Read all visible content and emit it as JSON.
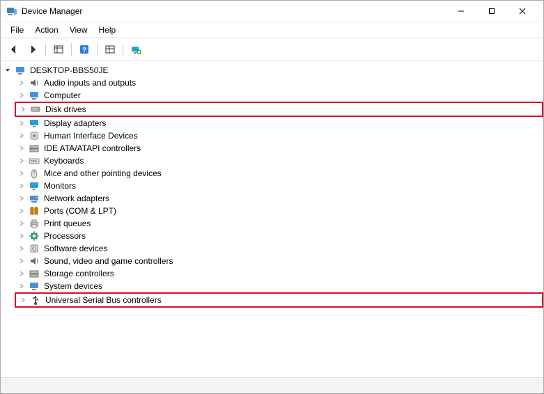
{
  "window": {
    "title": "Device Manager"
  },
  "menu": {
    "file": "File",
    "action": "Action",
    "view": "View",
    "help": "Help"
  },
  "tree": {
    "root": {
      "label": "DESKTOP-BBS50JE",
      "icon": "computer"
    },
    "categories": [
      {
        "label": "Audio inputs and outputs",
        "icon": "audio",
        "highlighted": false
      },
      {
        "label": "Computer",
        "icon": "computer",
        "highlighted": false
      },
      {
        "label": "Disk drives",
        "icon": "disk",
        "highlighted": true
      },
      {
        "label": "Display adapters",
        "icon": "display",
        "highlighted": false
      },
      {
        "label": "Human Interface Devices",
        "icon": "hid",
        "highlighted": false
      },
      {
        "label": "IDE ATA/ATAPI controllers",
        "icon": "storage",
        "highlighted": false
      },
      {
        "label": "Keyboards",
        "icon": "keyboard",
        "highlighted": false
      },
      {
        "label": "Mice and other pointing devices",
        "icon": "mouse",
        "highlighted": false
      },
      {
        "label": "Monitors",
        "icon": "monitor",
        "highlighted": false
      },
      {
        "label": "Network adapters",
        "icon": "network",
        "highlighted": false
      },
      {
        "label": "Ports (COM & LPT)",
        "icon": "port",
        "highlighted": false
      },
      {
        "label": "Print queues",
        "icon": "printer",
        "highlighted": false
      },
      {
        "label": "Processors",
        "icon": "cpu",
        "highlighted": false
      },
      {
        "label": "Software devices",
        "icon": "software",
        "highlighted": false
      },
      {
        "label": "Sound, video and game controllers",
        "icon": "sound",
        "highlighted": false
      },
      {
        "label": "Storage controllers",
        "icon": "storage",
        "highlighted": false
      },
      {
        "label": "System devices",
        "icon": "system",
        "highlighted": false
      },
      {
        "label": "Universal Serial Bus controllers",
        "icon": "usb",
        "highlighted": true
      }
    ]
  }
}
